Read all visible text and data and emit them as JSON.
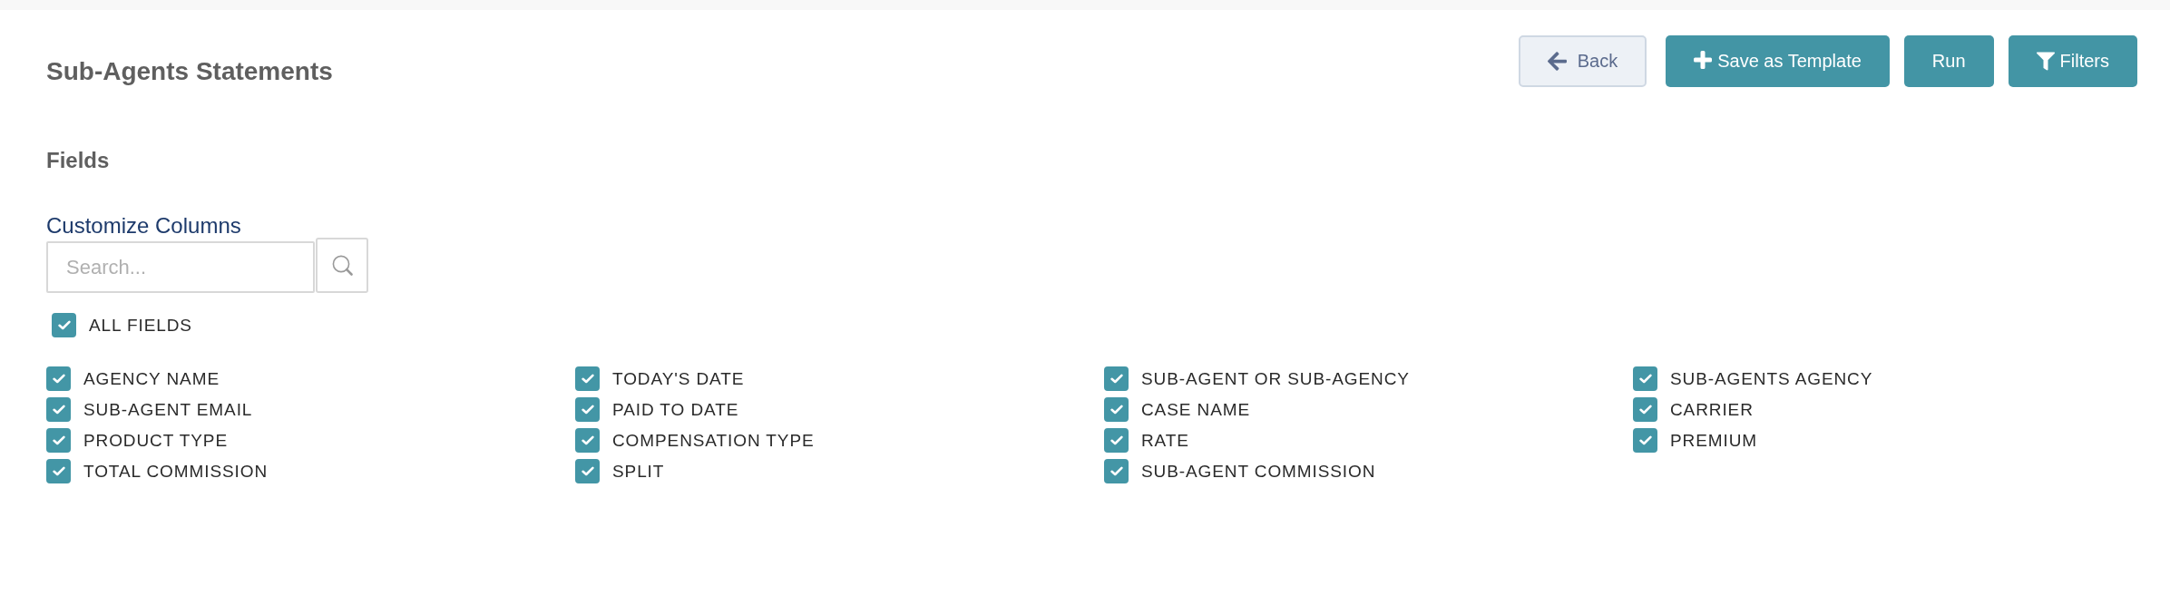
{
  "header": {
    "title": "Sub-Agents Statements",
    "buttons": [
      {
        "label": "Back",
        "kind": "back"
      },
      {
        "label": "Save as Template",
        "kind": "add"
      },
      {
        "label": "Run",
        "kind": "plain"
      },
      {
        "label": "Filters",
        "kind": "filter"
      }
    ]
  },
  "fields": {
    "heading": "Fields",
    "customize_label": "Customize Columns",
    "search": {
      "placeholder": "Search..."
    },
    "all_fields": {
      "label": "ALL FIELDS",
      "checked": true
    },
    "items": [
      {
        "label": "AGENCY NAME",
        "checked": true
      },
      {
        "label": "TODAY'S DATE",
        "checked": true
      },
      {
        "label": "SUB-AGENT OR SUB-AGENCY",
        "checked": true
      },
      {
        "label": "SUB-AGENTS AGENCY",
        "checked": true
      },
      {
        "label": "SUB-AGENT EMAIL",
        "checked": true
      },
      {
        "label": "PAID TO DATE",
        "checked": true
      },
      {
        "label": "CASE NAME",
        "checked": true
      },
      {
        "label": "CARRIER",
        "checked": true
      },
      {
        "label": "PRODUCT TYPE",
        "checked": true
      },
      {
        "label": "COMPENSATION TYPE",
        "checked": true
      },
      {
        "label": "RATE",
        "checked": true
      },
      {
        "label": "PREMIUM",
        "checked": true
      },
      {
        "label": "TOTAL COMMISSION",
        "checked": true
      },
      {
        "label": "SPLIT",
        "checked": true
      },
      {
        "label": "SUB-AGENT COMMISSION",
        "checked": true
      }
    ]
  }
}
